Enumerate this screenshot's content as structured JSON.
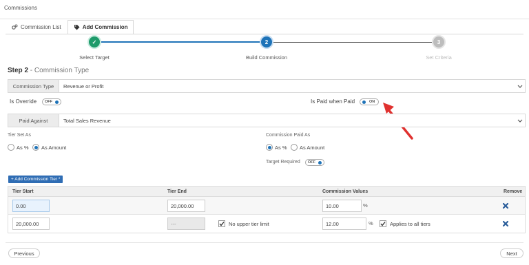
{
  "page": {
    "title": "Commissions"
  },
  "tabs": [
    {
      "label": "Commission List",
      "icon": "gears-icon",
      "active": false
    },
    {
      "label": "Add Commission",
      "icon": "tag-icon",
      "active": true
    }
  ],
  "stepper": {
    "steps": [
      {
        "number": "✓",
        "label": "Select Target",
        "state": "done"
      },
      {
        "number": "2",
        "label": "Build Commission",
        "state": "current"
      },
      {
        "number": "3",
        "label": "Set Criteria",
        "state": "pending"
      }
    ]
  },
  "section": {
    "step": "Step 2",
    "title": "- Commission Type"
  },
  "commission_type": {
    "label": "Commission Type",
    "value": "Revenue or Profit"
  },
  "is_override": {
    "label": "Is Override",
    "toggle": "OFF"
  },
  "is_paid_when_paid": {
    "label": "Is Paid when Paid",
    "toggle": "ON"
  },
  "paid_against": {
    "label": "Paid Against",
    "value": "Total Sales Revenue"
  },
  "tier_set_as": {
    "label": "Tier Set As",
    "options": [
      {
        "label": "As %",
        "checked": false
      },
      {
        "label": "As Amount",
        "checked": true
      }
    ]
  },
  "commission_paid_as": {
    "label": "Commission Paid As",
    "options": [
      {
        "label": "As %",
        "checked": true
      },
      {
        "label": "As Amount",
        "checked": false
      }
    ]
  },
  "target_required": {
    "label": "Target Required",
    "toggle": "OFF"
  },
  "add_tier_button": "+ Add Commission Tier *",
  "table": {
    "headers": {
      "tier_start": "Tier Start",
      "tier_end": "Tier End",
      "commission_values": "Commission Values",
      "remove": "Remove"
    },
    "rows": [
      {
        "tier_start": "0.00",
        "tier_end": "20,000.00",
        "commission": "10.00",
        "pct": "%"
      },
      {
        "tier_start": "20,000.00",
        "tier_end": "---",
        "no_upper_label": "No upper tier limit",
        "commission": "12.00",
        "pct": "%",
        "applies_label": "Applies to all tiers"
      }
    ]
  },
  "footer": {
    "previous": "Previous",
    "next": "Next"
  },
  "colors": {
    "accent": "#2f6db4",
    "done": "#1f9b6b",
    "current": "#1e73b8",
    "pending": "#bdbdbd",
    "arrow": "#e0312f"
  }
}
